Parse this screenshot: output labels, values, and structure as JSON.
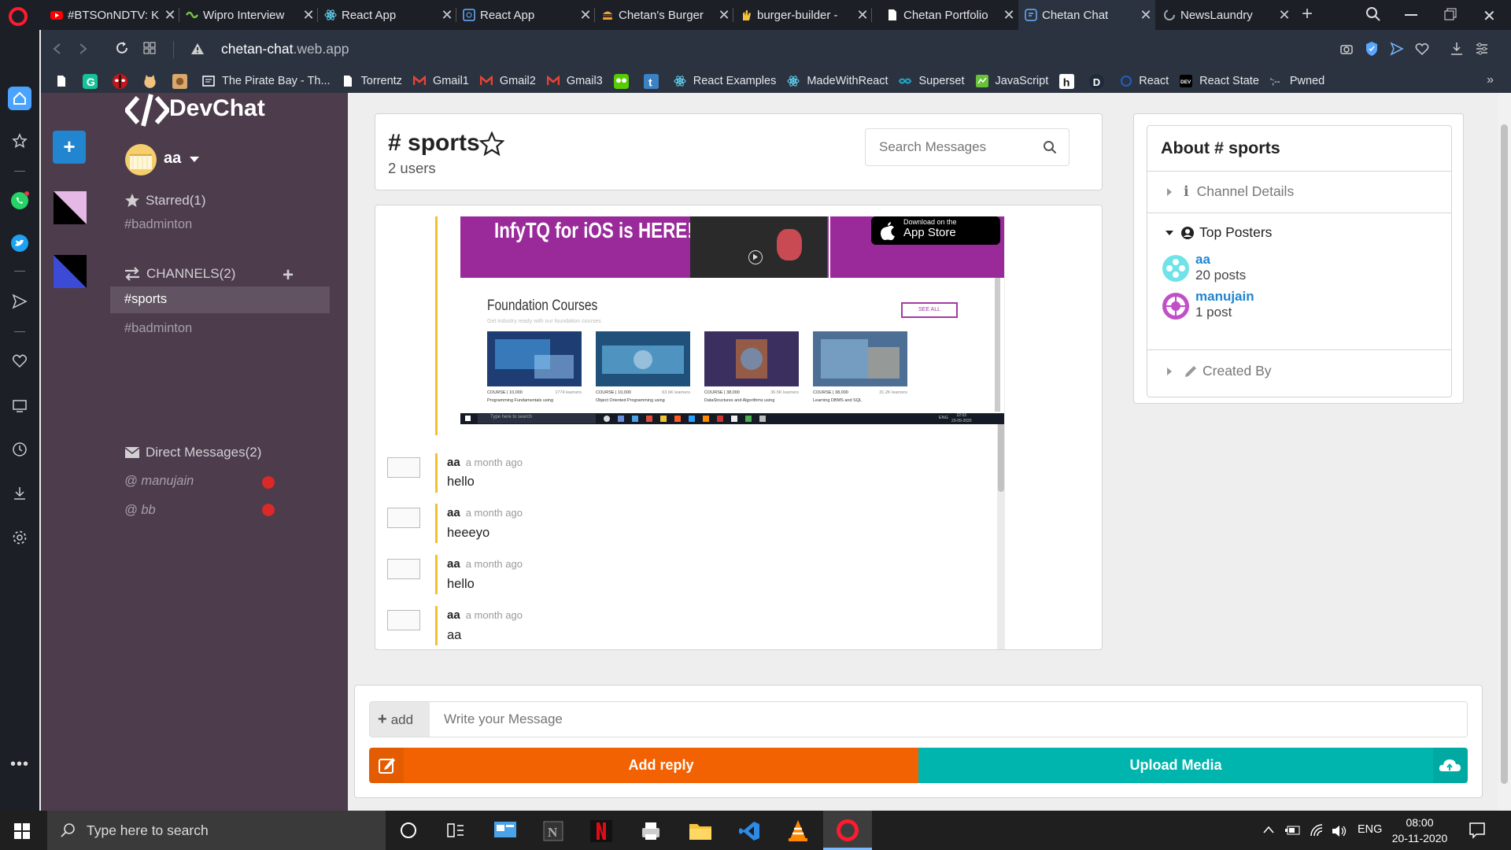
{
  "browser": {
    "tabs": [
      {
        "title": "#BTSOnNDTV: K"
      },
      {
        "title": "Wipro Interview"
      },
      {
        "title": "React App"
      },
      {
        "title": "React App"
      },
      {
        "title": "Chetan's Burger"
      },
      {
        "title": "burger-builder -"
      },
      {
        "title": "Chetan Portfolio"
      },
      {
        "title": "Chetan Chat"
      },
      {
        "title": "NewsLaundry"
      }
    ],
    "address": {
      "host": "chetan-chat",
      "domain": ".web.app"
    },
    "bookmarks": [
      "The Pirate Bay - Th...",
      "Torrentz",
      "Gmail1",
      "Gmail2",
      "Gmail3",
      "React Examples",
      "MadeWithReact",
      "Superset",
      "JavaScript",
      "React",
      "React State",
      "Pwned"
    ]
  },
  "app": {
    "brand": "DevChat",
    "user": {
      "name": "aa"
    },
    "starred": {
      "header": "Starred(1)",
      "items": [
        "#badminton"
      ]
    },
    "channels": {
      "header": "CHANNELS(2)",
      "items": [
        "#sports",
        "#badminton"
      ]
    },
    "direct": {
      "header": "Direct Messages(2)",
      "items": [
        "@ manujain",
        "@ bb"
      ]
    }
  },
  "channel": {
    "name": "# sports",
    "users": "2 users",
    "search_placeholder": "Search Messages"
  },
  "screenshot": {
    "banner": "InfyTQ for iOS is HERE!",
    "store_small": "Download on the",
    "store_big": "App Store",
    "section": "Foundation Courses",
    "section_sub": "Get industry ready with our foundation courses",
    "see_all": "SEE ALL",
    "courses": [
      {
        "tag": "COURSE | 10,000",
        "learners": "1774 learners",
        "name": "Programming Fundamentals using"
      },
      {
        "tag": "COURSE | 10,000",
        "learners": "63.6K learners",
        "name": "Object Oriented Programming using"
      },
      {
        "tag": "COURSE | 38,000",
        "learners": "36.5K learners",
        "name": "DataStructures and Algorithms using"
      },
      {
        "tag": "COURSE | 38,000",
        "learners": "31.2K learners",
        "name": "Learning DBMS and SQL"
      }
    ],
    "taskbar_search": "Type here to search",
    "tray_lang": "ENG",
    "tray_time": "22:03",
    "tray_date": "23-09-2020"
  },
  "messages": [
    {
      "author": "aa",
      "time": "a month ago",
      "text": "hello"
    },
    {
      "author": "aa",
      "time": "a month ago",
      "text": "heeeyo"
    },
    {
      "author": "aa",
      "time": "a month ago",
      "text": "hello"
    },
    {
      "author": "aa",
      "time": "a month ago",
      "text": "aa"
    }
  ],
  "composer": {
    "add_label": "add",
    "placeholder": "Write your Message",
    "reply_label": "Add reply",
    "upload_label": "Upload Media"
  },
  "about": {
    "title": "About # sports",
    "channel_details": "Channel Details",
    "top_posters": "Top Posters",
    "posters": [
      {
        "name": "aa",
        "count": "20 posts"
      },
      {
        "name": "manujain",
        "count": "1 post"
      }
    ],
    "created_by": "Created By"
  },
  "taskbar": {
    "search": "Type here to search",
    "lang": "ENG",
    "time": "08:00",
    "date": "20-11-2020"
  },
  "colors": {
    "sidebar": "#4c3c4c",
    "orange": "#f26202",
    "teal": "#00b5ad",
    "link": "#2185d0",
    "accent": "#f2c12e"
  }
}
